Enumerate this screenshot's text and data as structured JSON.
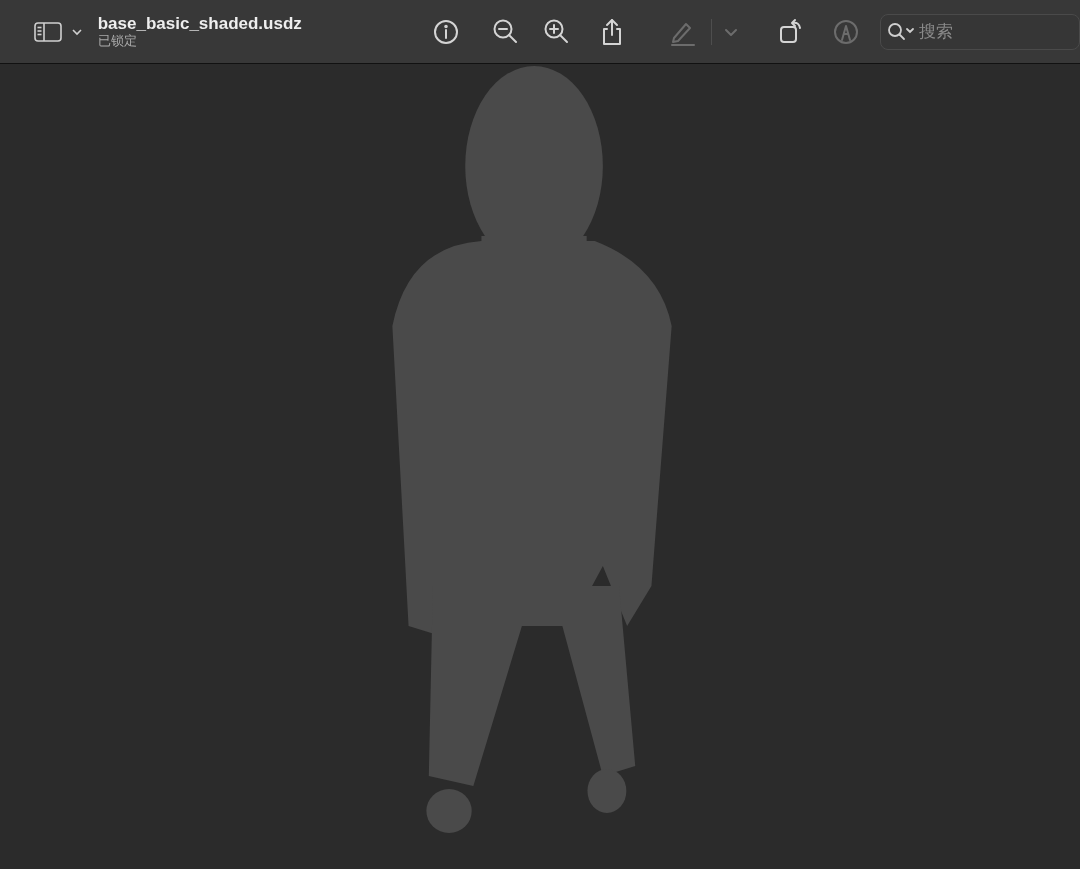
{
  "window": {
    "title": "base_basic_shaded.usdz",
    "subtitle": "已锁定"
  },
  "toolbar": {
    "tools": [
      {
        "kind": "info",
        "disabled": false
      },
      {
        "kind": "zoom-out",
        "disabled": false
      },
      {
        "kind": "zoom-in",
        "disabled": false
      },
      {
        "kind": "share",
        "disabled": false
      },
      {
        "kind": "pen",
        "disabled": true
      },
      {
        "kind": "separator",
        "disabled": true
      },
      {
        "kind": "chevron",
        "disabled": true
      },
      {
        "kind": "rotate",
        "disabled": false
      },
      {
        "kind": "markup",
        "disabled": true
      }
    ]
  },
  "search": {
    "placeholder": "搜索"
  }
}
